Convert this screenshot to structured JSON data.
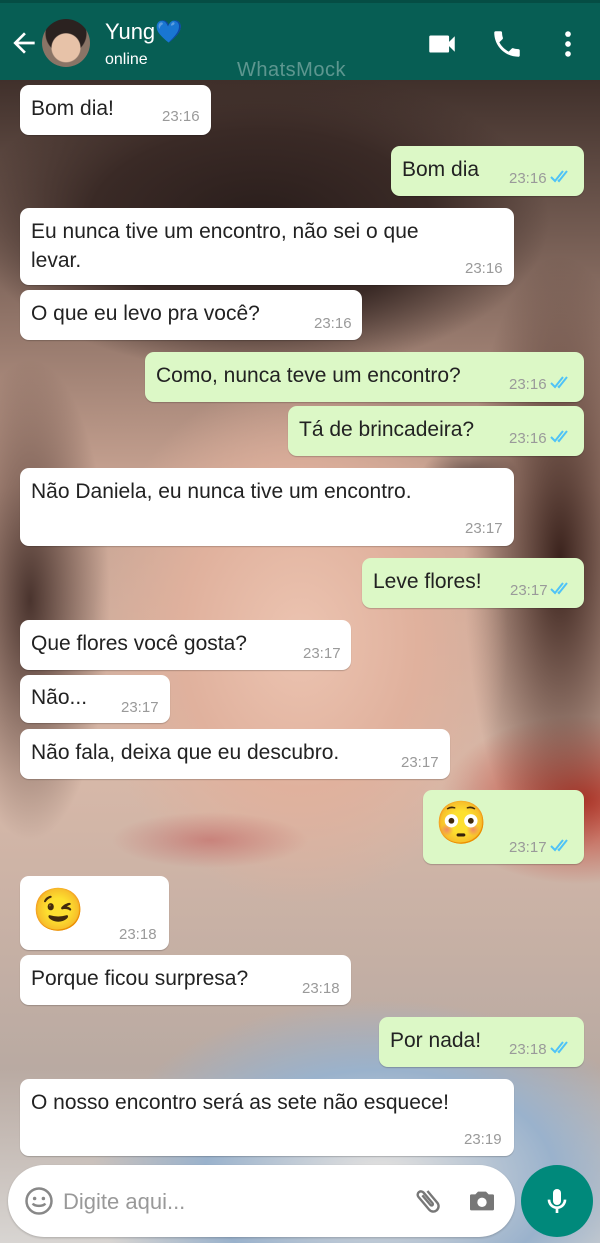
{
  "header": {
    "contact_name": "Yung💙",
    "status": "online",
    "watermark": "WhatsMock",
    "icons": [
      "back-arrow-icon",
      "video-call-icon",
      "phone-icon",
      "more-vert-icon"
    ]
  },
  "messages": [
    {
      "dir": "in",
      "text": "Bom dia!",
      "time": "23:16"
    },
    {
      "dir": "out",
      "text": "Bom dia",
      "time": "23:16",
      "read": true
    },
    {
      "dir": "in",
      "text": "Eu nunca tive um encontro, não sei o que levar.",
      "time": "23:16"
    },
    {
      "dir": "in",
      "text": "O que eu levo pra você?",
      "time": "23:16"
    },
    {
      "dir": "out",
      "text": "Como, nunca teve um encontro?",
      "time": "23:16",
      "read": true
    },
    {
      "dir": "out",
      "text": "Tá de brincadeira?",
      "time": "23:16",
      "read": true
    },
    {
      "dir": "in",
      "text": "Não Daniela, eu nunca tive um encontro.",
      "time": "23:17"
    },
    {
      "dir": "out",
      "text": "Leve flores!",
      "time": "23:17",
      "read": true
    },
    {
      "dir": "in",
      "text": "Que flores você gosta?",
      "time": "23:17"
    },
    {
      "dir": "in",
      "text": "Não...",
      "time": "23:17"
    },
    {
      "dir": "in",
      "text": "Não fala, deixa que eu descubro.",
      "time": "23:17"
    },
    {
      "dir": "out",
      "text": "😳",
      "time": "23:17",
      "read": true
    },
    {
      "dir": "in",
      "text": "😉",
      "time": "23:18"
    },
    {
      "dir": "in",
      "text": "Porque ficou surpresa?",
      "time": "23:18"
    },
    {
      "dir": "out",
      "text": "Por nada!",
      "time": "23:18",
      "read": true
    },
    {
      "dir": "in",
      "text": "O nosso encontro será as sete não esquece!",
      "time": "23:19"
    }
  ],
  "composer": {
    "placeholder": "Digite aqui...",
    "icons": [
      "emoji-icon",
      "attach-icon",
      "camera-icon",
      "mic-icon"
    ]
  },
  "colors": {
    "header": "#075e54",
    "incoming_bubble": "#ffffff",
    "outgoing_bubble": "#dcf8c6",
    "read_tick": "#4fc3f7",
    "mic_button": "#00897b"
  }
}
